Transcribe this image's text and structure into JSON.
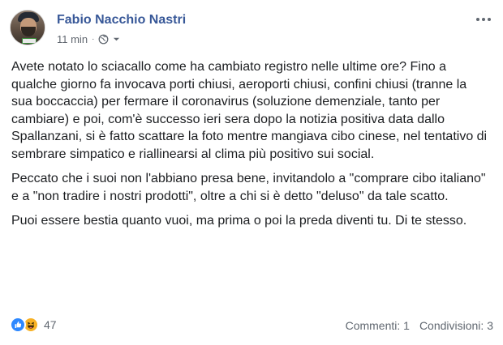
{
  "post": {
    "author": "Fabio Nacchio Nastri",
    "time": "11 min",
    "separator": "·",
    "privacy_icon": "globe-icon",
    "audience_menu_icon": "caret-down-icon",
    "options_icon": "more-icon",
    "paragraphs": [
      "Avete notato lo sciacallo come ha cambiato registro nelle ultime ore? Fino a qualche giorno fa invocava porti chiusi, aeroporti chiusi, confini chiusi (tranne la sua boccaccia) per fermare il coronavirus (soluzione demenziale, tanto per cambiare) e poi, com'è successo ieri sera dopo la notizia positiva data dallo Spallanzani, si è fatto scattare la foto mentre mangiava cibo cinese, nel tentativo di sembrare simpatico e riallinearsi al clima più positivo sui social.",
      "Peccato che i suoi non l'abbiano presa bene, invitandolo a \"comprare cibo italiano\" e a \"non tradire i nostri prodotti\", oltre a chi si è detto \"deluso\" da tale scatto.",
      "Puoi essere bestia quanto vuoi, ma prima o poi la preda diventi tu. Di te stesso."
    ]
  },
  "footer": {
    "reaction_icons": [
      "like-icon",
      "haha-icon"
    ],
    "reaction_count": "47",
    "comments": "Commenti: 1",
    "shares": "Condivisioni: 3"
  },
  "colors": {
    "author_link": "#385898",
    "meta_text": "#616770",
    "body_text": "#1c1e21",
    "like_blue": "#2d88ff",
    "haha_yellow": "#f7b125"
  }
}
